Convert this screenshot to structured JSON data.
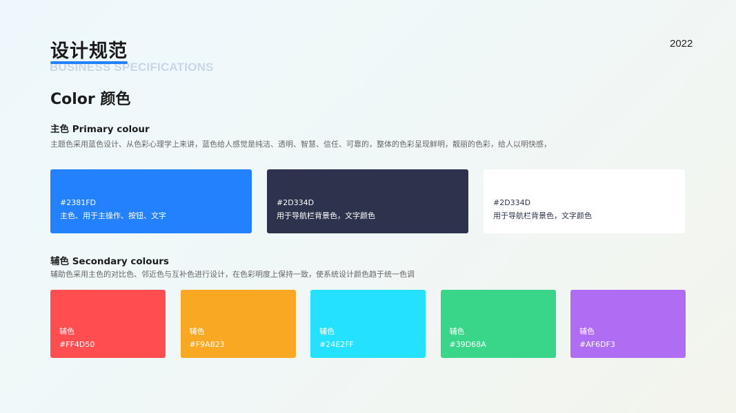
{
  "header": {
    "title": "设计规范",
    "subtitle_en": "BUSINESS SPECIFICATIONS",
    "year": "2022"
  },
  "section": {
    "title": "Color 颜色"
  },
  "primary": {
    "heading": "主色 Primary colour",
    "description": "主题色采用蓝色设计、从色彩心理学上来讲，蓝色给人感觉是纯洁、透明、智慧、信任、可靠的，整体的色彩呈现鲜明，靓丽的色彩，给人以明快感，",
    "cards": [
      {
        "hex": "#2381FD",
        "usage": "主色、用于主操作、按钮、文字",
        "bg": "#2381FD",
        "text_color": "#ffffff"
      },
      {
        "hex": "#2D334D",
        "usage": "用于导航栏背景色，文字颜色",
        "bg": "#2D334D",
        "text_color": "#ffffff"
      },
      {
        "hex": "#2D334D",
        "usage": "用于导航栏背景色，文字颜色",
        "bg": "#ffffff",
        "text_color": "#2D334D"
      }
    ]
  },
  "secondary": {
    "heading": "辅色 Secondary colours",
    "description": "辅助色采用主色的对比色、邻近色与互补色进行设计，在色彩明度上保持一致，使系统设计颜色趋于统一色调",
    "cards": [
      {
        "label": "辅色",
        "hex": "#FF4D50",
        "bg": "#FF4D50"
      },
      {
        "label": "辅色",
        "hex": "#F9A823",
        "bg": "#F9A823"
      },
      {
        "label": "辅色",
        "hex": "#24E2FF",
        "bg": "#24E2FF"
      },
      {
        "label": "辅色",
        "hex": "#39D68A",
        "bg": "#39D68A"
      },
      {
        "label": "辅色",
        "hex": "#AF6DF3",
        "bg": "#AF6DF3"
      }
    ]
  }
}
